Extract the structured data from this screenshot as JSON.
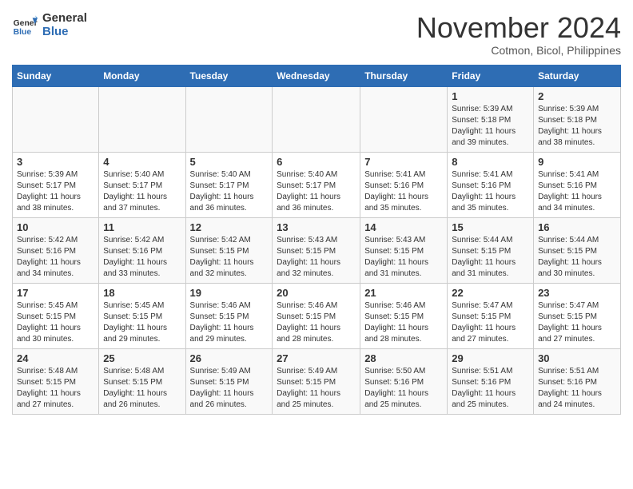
{
  "logo": {
    "line1": "General",
    "line2": "Blue"
  },
  "title": "November 2024",
  "subtitle": "Cotmon, Bicol, Philippines",
  "headers": [
    "Sunday",
    "Monday",
    "Tuesday",
    "Wednesday",
    "Thursday",
    "Friday",
    "Saturday"
  ],
  "weeks": [
    [
      {
        "day": "",
        "detail": ""
      },
      {
        "day": "",
        "detail": ""
      },
      {
        "day": "",
        "detail": ""
      },
      {
        "day": "",
        "detail": ""
      },
      {
        "day": "",
        "detail": ""
      },
      {
        "day": "1",
        "detail": "Sunrise: 5:39 AM\nSunset: 5:18 PM\nDaylight: 11 hours\nand 39 minutes."
      },
      {
        "day": "2",
        "detail": "Sunrise: 5:39 AM\nSunset: 5:18 PM\nDaylight: 11 hours\nand 38 minutes."
      }
    ],
    [
      {
        "day": "3",
        "detail": "Sunrise: 5:39 AM\nSunset: 5:17 PM\nDaylight: 11 hours\nand 38 minutes."
      },
      {
        "day": "4",
        "detail": "Sunrise: 5:40 AM\nSunset: 5:17 PM\nDaylight: 11 hours\nand 37 minutes."
      },
      {
        "day": "5",
        "detail": "Sunrise: 5:40 AM\nSunset: 5:17 PM\nDaylight: 11 hours\nand 36 minutes."
      },
      {
        "day": "6",
        "detail": "Sunrise: 5:40 AM\nSunset: 5:17 PM\nDaylight: 11 hours\nand 36 minutes."
      },
      {
        "day": "7",
        "detail": "Sunrise: 5:41 AM\nSunset: 5:16 PM\nDaylight: 11 hours\nand 35 minutes."
      },
      {
        "day": "8",
        "detail": "Sunrise: 5:41 AM\nSunset: 5:16 PM\nDaylight: 11 hours\nand 35 minutes."
      },
      {
        "day": "9",
        "detail": "Sunrise: 5:41 AM\nSunset: 5:16 PM\nDaylight: 11 hours\nand 34 minutes."
      }
    ],
    [
      {
        "day": "10",
        "detail": "Sunrise: 5:42 AM\nSunset: 5:16 PM\nDaylight: 11 hours\nand 34 minutes."
      },
      {
        "day": "11",
        "detail": "Sunrise: 5:42 AM\nSunset: 5:16 PM\nDaylight: 11 hours\nand 33 minutes."
      },
      {
        "day": "12",
        "detail": "Sunrise: 5:42 AM\nSunset: 5:15 PM\nDaylight: 11 hours\nand 32 minutes."
      },
      {
        "day": "13",
        "detail": "Sunrise: 5:43 AM\nSunset: 5:15 PM\nDaylight: 11 hours\nand 32 minutes."
      },
      {
        "day": "14",
        "detail": "Sunrise: 5:43 AM\nSunset: 5:15 PM\nDaylight: 11 hours\nand 31 minutes."
      },
      {
        "day": "15",
        "detail": "Sunrise: 5:44 AM\nSunset: 5:15 PM\nDaylight: 11 hours\nand 31 minutes."
      },
      {
        "day": "16",
        "detail": "Sunrise: 5:44 AM\nSunset: 5:15 PM\nDaylight: 11 hours\nand 30 minutes."
      }
    ],
    [
      {
        "day": "17",
        "detail": "Sunrise: 5:45 AM\nSunset: 5:15 PM\nDaylight: 11 hours\nand 30 minutes."
      },
      {
        "day": "18",
        "detail": "Sunrise: 5:45 AM\nSunset: 5:15 PM\nDaylight: 11 hours\nand 29 minutes."
      },
      {
        "day": "19",
        "detail": "Sunrise: 5:46 AM\nSunset: 5:15 PM\nDaylight: 11 hours\nand 29 minutes."
      },
      {
        "day": "20",
        "detail": "Sunrise: 5:46 AM\nSunset: 5:15 PM\nDaylight: 11 hours\nand 28 minutes."
      },
      {
        "day": "21",
        "detail": "Sunrise: 5:46 AM\nSunset: 5:15 PM\nDaylight: 11 hours\nand 28 minutes."
      },
      {
        "day": "22",
        "detail": "Sunrise: 5:47 AM\nSunset: 5:15 PM\nDaylight: 11 hours\nand 27 minutes."
      },
      {
        "day": "23",
        "detail": "Sunrise: 5:47 AM\nSunset: 5:15 PM\nDaylight: 11 hours\nand 27 minutes."
      }
    ],
    [
      {
        "day": "24",
        "detail": "Sunrise: 5:48 AM\nSunset: 5:15 PM\nDaylight: 11 hours\nand 27 minutes."
      },
      {
        "day": "25",
        "detail": "Sunrise: 5:48 AM\nSunset: 5:15 PM\nDaylight: 11 hours\nand 26 minutes."
      },
      {
        "day": "26",
        "detail": "Sunrise: 5:49 AM\nSunset: 5:15 PM\nDaylight: 11 hours\nand 26 minutes."
      },
      {
        "day": "27",
        "detail": "Sunrise: 5:49 AM\nSunset: 5:15 PM\nDaylight: 11 hours\nand 25 minutes."
      },
      {
        "day": "28",
        "detail": "Sunrise: 5:50 AM\nSunset: 5:16 PM\nDaylight: 11 hours\nand 25 minutes."
      },
      {
        "day": "29",
        "detail": "Sunrise: 5:51 AM\nSunset: 5:16 PM\nDaylight: 11 hours\nand 25 minutes."
      },
      {
        "day": "30",
        "detail": "Sunrise: 5:51 AM\nSunset: 5:16 PM\nDaylight: 11 hours\nand 24 minutes."
      }
    ]
  ]
}
